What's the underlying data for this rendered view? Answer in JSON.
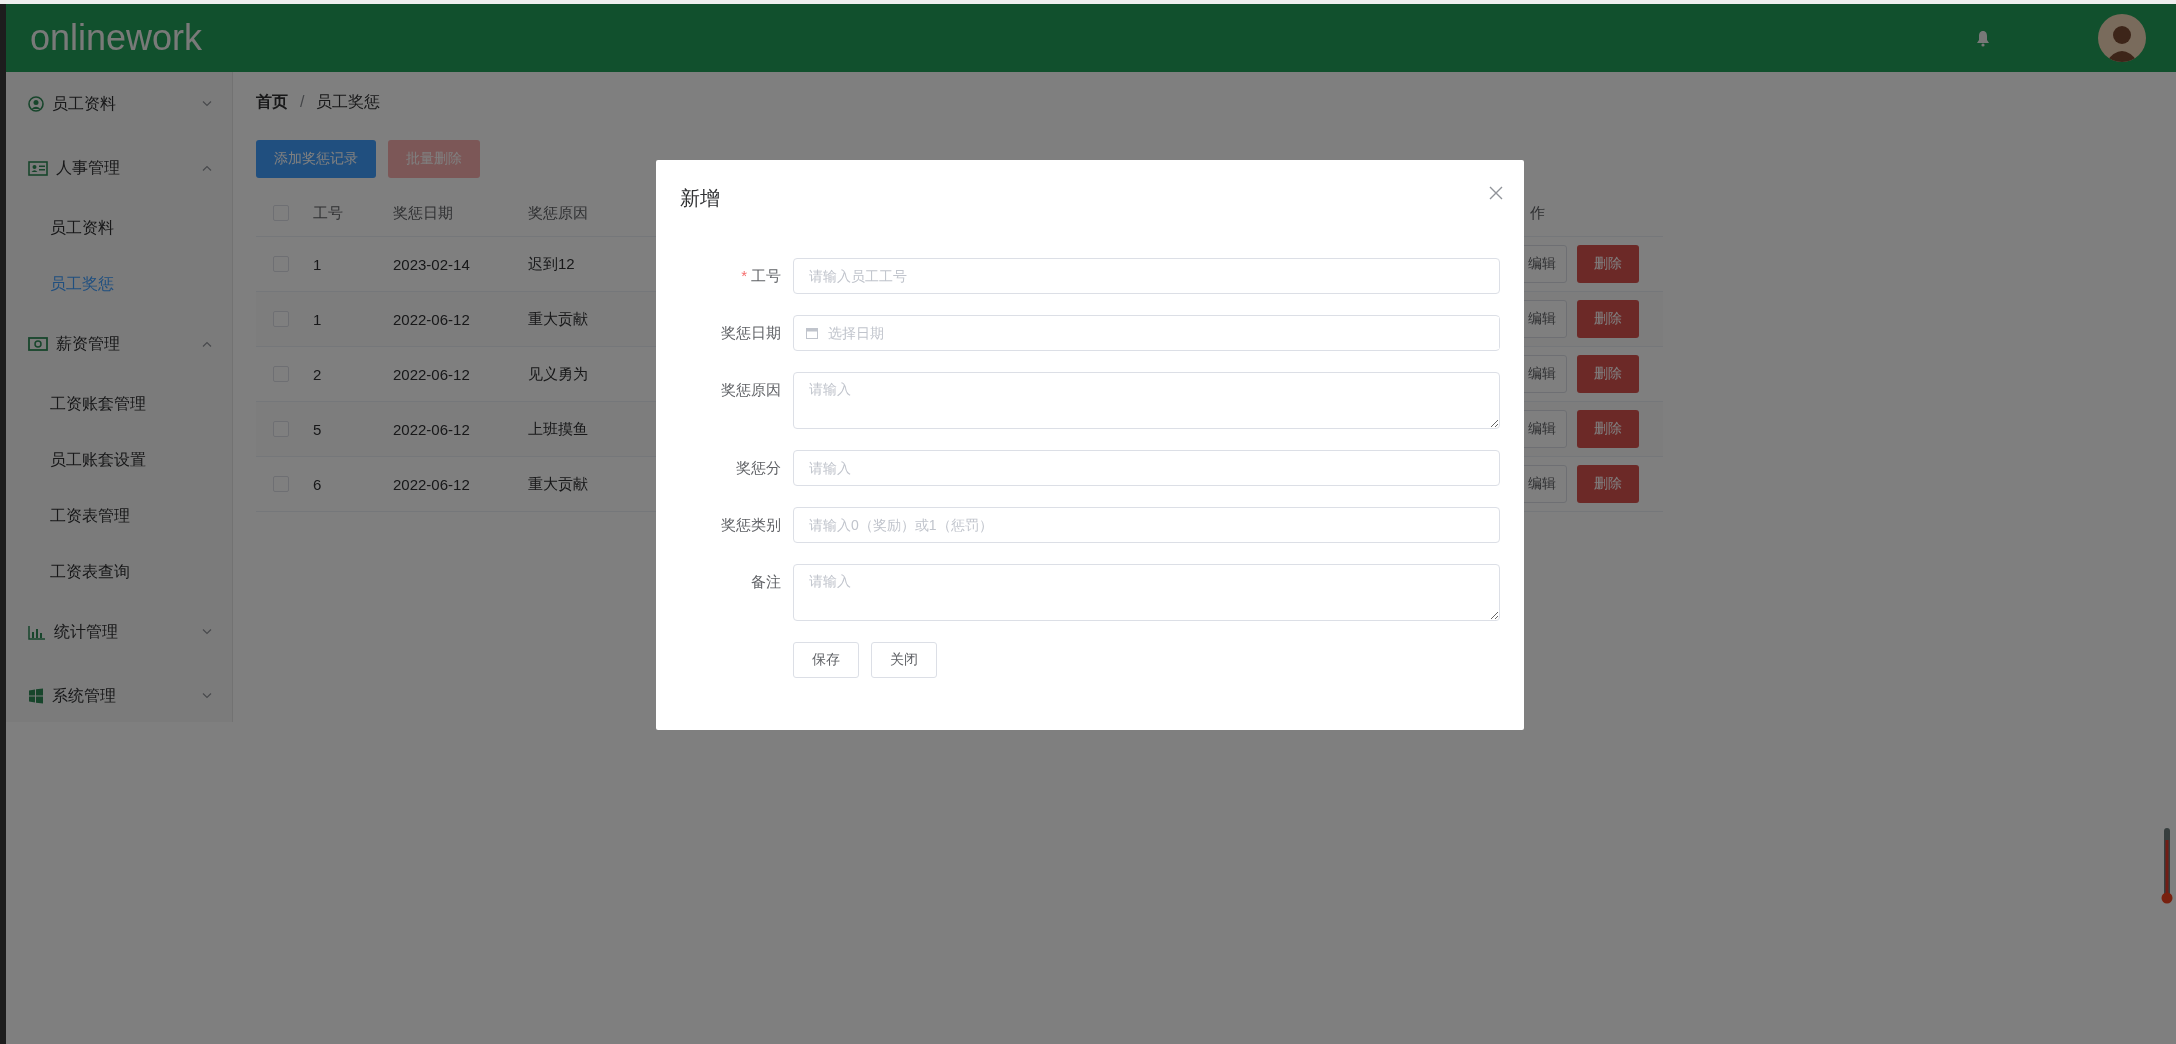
{
  "header": {
    "logo": "onlinework"
  },
  "sidebar": {
    "groups": [
      {
        "label": "员工资料",
        "expanded": false
      },
      {
        "label": "人事管理",
        "expanded": true,
        "children": [
          {
            "label": "员工资料",
            "selected": false
          },
          {
            "label": "员工奖惩",
            "selected": true
          }
        ]
      },
      {
        "label": "薪资管理",
        "expanded": true,
        "children": [
          {
            "label": "工资账套管理",
            "selected": false
          },
          {
            "label": "员工账套设置",
            "selected": false
          },
          {
            "label": "工资表管理",
            "selected": false
          },
          {
            "label": "工资表查询",
            "selected": false
          }
        ]
      },
      {
        "label": "统计管理",
        "expanded": false
      },
      {
        "label": "系统管理",
        "expanded": false
      }
    ]
  },
  "breadcrumb": [
    "首页",
    "员工奖惩"
  ],
  "breadcrumb_separator": "/",
  "toolbar": [
    {
      "label": "添加奖惩记录",
      "kind": "primary",
      "disabled": false
    },
    {
      "label": "批量删除",
      "kind": "danger",
      "disabled": true
    }
  ],
  "table": {
    "select_all_checked": false,
    "columns": [
      "工号",
      "奖惩日期",
      "奖惩原因"
    ],
    "actions_header": "作",
    "rows": [
      {
        "checked": false,
        "cells": [
          "1",
          "2023-02-14",
          "迟到12"
        ],
        "edit": "编辑",
        "delete": "删除"
      },
      {
        "checked": false,
        "cells": [
          "1",
          "2022-06-12",
          "重大贡献"
        ],
        "edit": "编辑",
        "delete": "删除"
      },
      {
        "checked": false,
        "cells": [
          "2",
          "2022-06-12",
          "见义勇为"
        ],
        "edit": "编辑",
        "delete": "删除"
      },
      {
        "checked": false,
        "cells": [
          "5",
          "2022-06-12",
          "上班摸鱼"
        ],
        "edit": "编辑",
        "delete": "删除"
      },
      {
        "checked": false,
        "cells": [
          "6",
          "2022-06-12",
          "重大贡献"
        ],
        "edit": "编辑",
        "delete": "删除"
      }
    ]
  },
  "dialog": {
    "title": "新增",
    "required_mark": "*",
    "fields": [
      {
        "label": "工号",
        "required": true,
        "kind": "input",
        "placeholder": "请输入员工工号"
      },
      {
        "label": "奖惩日期",
        "required": false,
        "kind": "date",
        "placeholder": "选择日期"
      },
      {
        "label": "奖惩原因",
        "required": false,
        "kind": "textarea",
        "placeholder": "请输入"
      },
      {
        "label": "奖惩分",
        "required": false,
        "kind": "input",
        "placeholder": "请输入"
      },
      {
        "label": "奖惩类别",
        "required": false,
        "kind": "input",
        "placeholder": "请输入0（奖励）或1（惩罚）"
      },
      {
        "label": "备注",
        "required": false,
        "kind": "textarea",
        "placeholder": "请输入"
      }
    ],
    "buttons": [
      "保存",
      "关闭"
    ]
  }
}
